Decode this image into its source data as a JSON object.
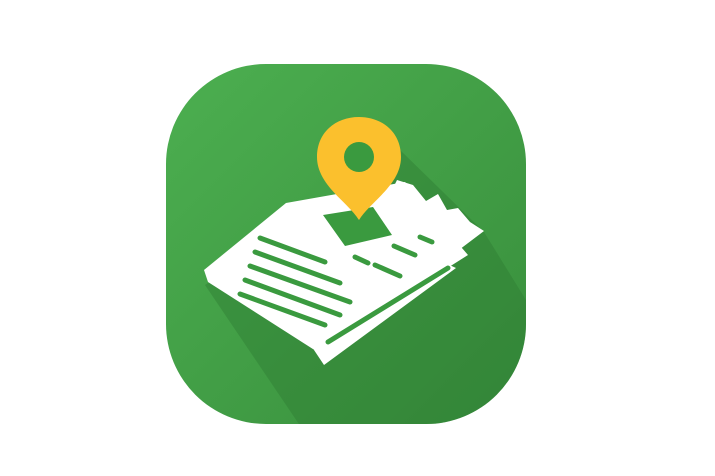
{
  "icon": {
    "name": "local-news-map-pin-app-icon",
    "tile_color_light": "#4caf50",
    "tile_color_dark": "#388e3c",
    "shadow_color": "#2e7d32",
    "paper_color": "#ffffff",
    "pin_color": "#fbc02d",
    "pin_hole_color": "#3a9a3f",
    "photo_block_color": "#3a9a3f",
    "text_line_color": "#3a9a3f"
  }
}
